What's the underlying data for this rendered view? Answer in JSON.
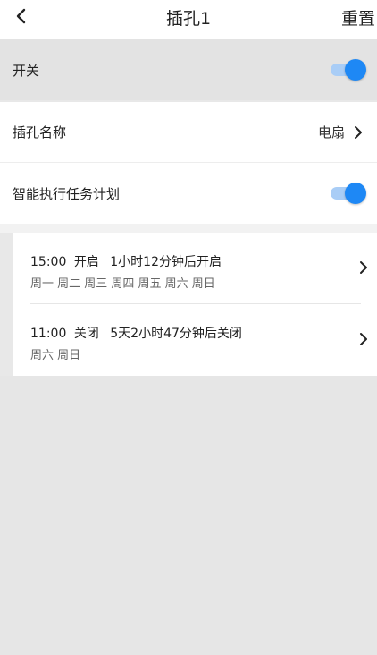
{
  "header": {
    "title": "插孔1",
    "reset_label": "重置",
    "back_icon": "chevron-left-icon"
  },
  "power_switch": {
    "label": "开关",
    "on": true,
    "accent": "#1e88f5"
  },
  "socket_name": {
    "label": "插孔名称",
    "value": "电扇"
  },
  "smart_schedule": {
    "label": "智能执行任务计划",
    "on": true
  },
  "plans": [
    {
      "time": "15:00",
      "action": "开启",
      "countdown": "1小时12分钟后开启",
      "days": "周一 周二 周三 周四 周五 周六 周日"
    },
    {
      "time": "11:00",
      "action": "关闭",
      "countdown": "5天2小时47分钟后关闭",
      "days": "周六 周日"
    }
  ]
}
